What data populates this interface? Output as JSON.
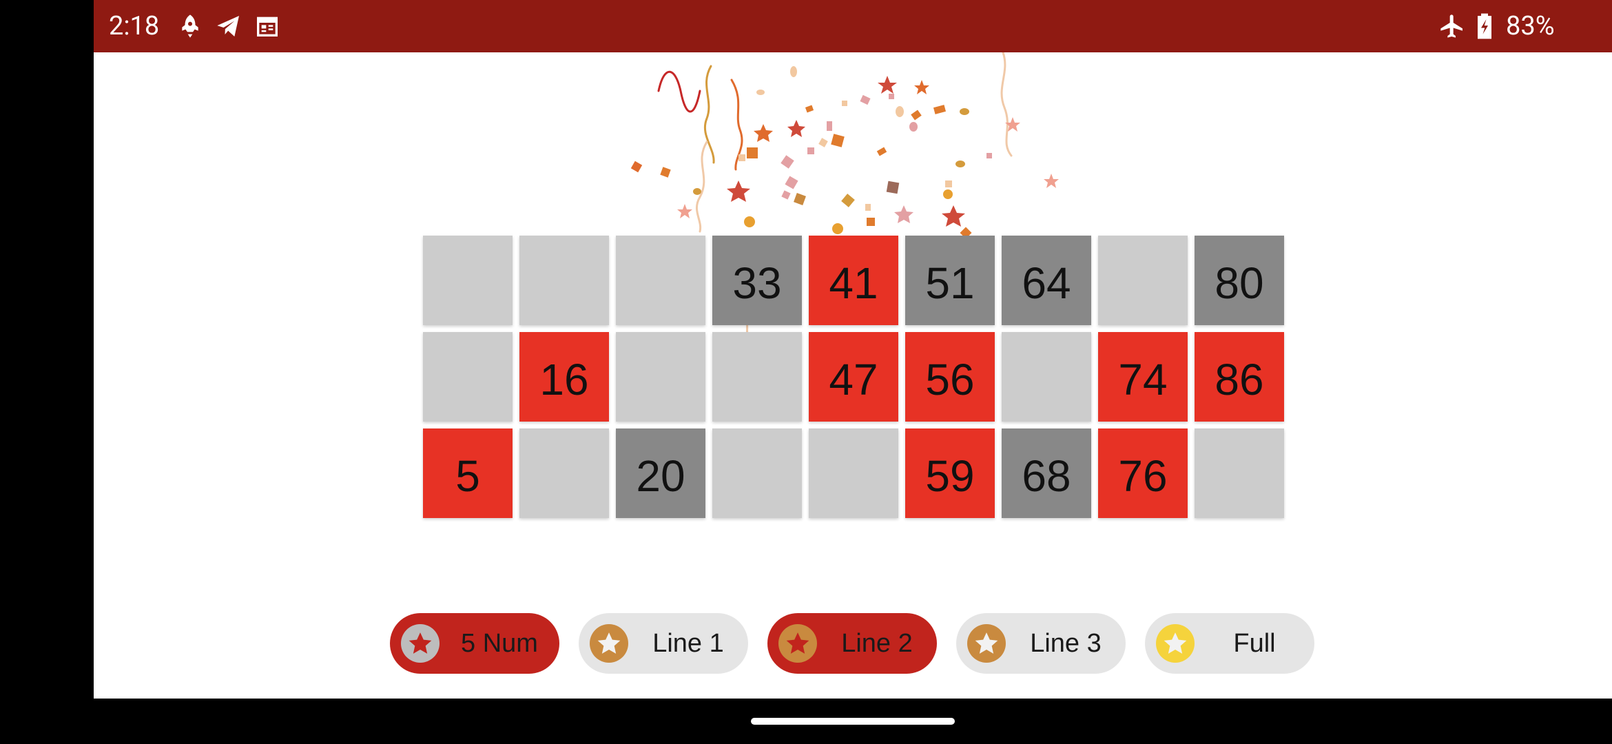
{
  "status_bar": {
    "time": "2:18",
    "battery": "83%",
    "icons_left": [
      "rocket-icon",
      "send-icon",
      "calendar-icon"
    ],
    "icons_right": [
      "airplane-mode-icon",
      "battery-charging-icon"
    ]
  },
  "board": {
    "rows": [
      [
        {
          "value": "",
          "state": "empty"
        },
        {
          "value": "",
          "state": "empty"
        },
        {
          "value": "",
          "state": "empty"
        },
        {
          "value": "33",
          "state": "called"
        },
        {
          "value": "41",
          "state": "marked"
        },
        {
          "value": "51",
          "state": "called"
        },
        {
          "value": "64",
          "state": "called"
        },
        {
          "value": "",
          "state": "empty"
        },
        {
          "value": "80",
          "state": "called"
        }
      ],
      [
        {
          "value": "",
          "state": "empty"
        },
        {
          "value": "16",
          "state": "marked"
        },
        {
          "value": "",
          "state": "empty"
        },
        {
          "value": "",
          "state": "empty"
        },
        {
          "value": "47",
          "state": "marked"
        },
        {
          "value": "56",
          "state": "marked"
        },
        {
          "value": "",
          "state": "empty"
        },
        {
          "value": "74",
          "state": "marked"
        },
        {
          "value": "86",
          "state": "marked"
        }
      ],
      [
        {
          "value": "5",
          "state": "marked"
        },
        {
          "value": "",
          "state": "empty"
        },
        {
          "value": "20",
          "state": "called"
        },
        {
          "value": "",
          "state": "empty"
        },
        {
          "value": "",
          "state": "empty"
        },
        {
          "value": "59",
          "state": "marked"
        },
        {
          "value": "68",
          "state": "called"
        },
        {
          "value": "76",
          "state": "marked"
        },
        {
          "value": "",
          "state": "empty"
        }
      ]
    ]
  },
  "prizes": [
    {
      "label": "5 Num",
      "icon": "star-icon",
      "active": true,
      "badge_color": "#bdbdbd",
      "star_color": "#c1241d"
    },
    {
      "label": "Line 1",
      "icon": "star-icon",
      "active": false,
      "badge_color": "#c98a3f",
      "star_color": "#f2f2f2"
    },
    {
      "label": "Line 2",
      "icon": "star-icon",
      "active": true,
      "badge_color": "#c98a3f",
      "star_color": "#c1241d"
    },
    {
      "label": "Line 3",
      "icon": "star-icon",
      "active": false,
      "badge_color": "#c98a3f",
      "star_color": "#f2f2f2"
    },
    {
      "label": "Full",
      "icon": "star-icon",
      "active": false,
      "badge_color": "#f5d33c",
      "star_color": "#f2f2f2"
    }
  ],
  "colors": {
    "status_bar": "#8f1a12",
    "cell_marked": "#e73225",
    "cell_called": "#888888",
    "cell_empty": "#cccccc",
    "chip_active": "#c1241d",
    "chip_inactive": "#e5e5e5"
  }
}
